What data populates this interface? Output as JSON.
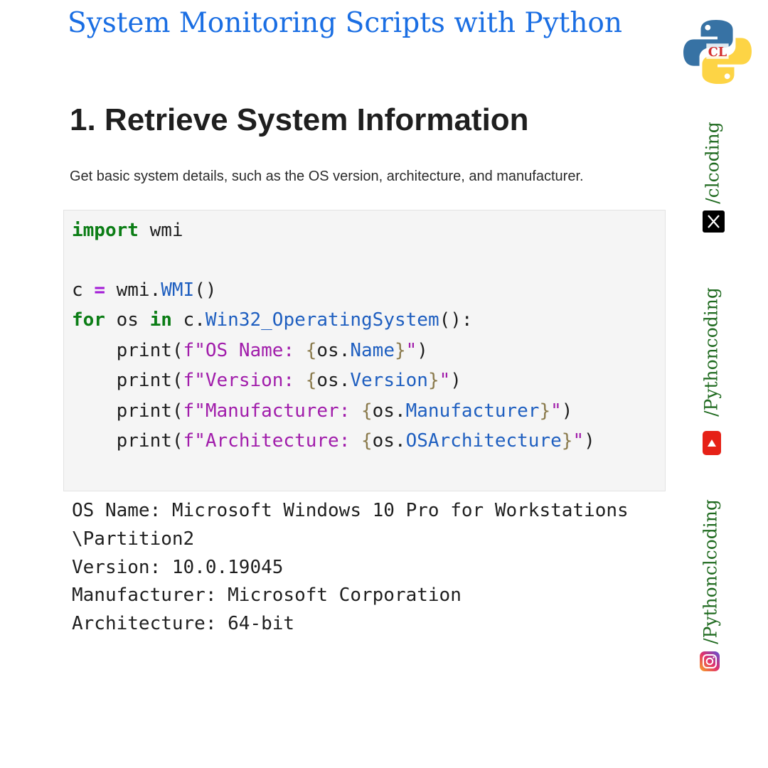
{
  "header": {
    "title": "System Monitoring Scripts with Python",
    "logo_name": "python-clcoding-logo",
    "logo_text": "CL"
  },
  "section": {
    "heading": "1. Retrieve System Information",
    "description": "Get basic system details, such as the OS version, architecture, and manufacturer."
  },
  "code": {
    "lines": [
      [
        {
          "t": "import",
          "c": "kw"
        },
        {
          "t": " wmi"
        }
      ],
      [],
      [
        {
          "t": "c "
        },
        {
          "t": "=",
          "c": "op"
        },
        {
          "t": " wmi."
        },
        {
          "t": "WMI",
          "c": "cls"
        },
        {
          "t": "()"
        }
      ],
      [
        {
          "t": "for",
          "c": "kw"
        },
        {
          "t": " os "
        },
        {
          "t": "in",
          "c": "kw"
        },
        {
          "t": " c."
        },
        {
          "t": "Win32_OperatingSystem",
          "c": "cls"
        },
        {
          "t": "():"
        }
      ],
      [
        {
          "t": "    print("
        },
        {
          "t": "f\"OS Name: ",
          "c": "str"
        },
        {
          "t": "{",
          "c": "brace"
        },
        {
          "t": "os."
        },
        {
          "t": "Name",
          "c": "cls"
        },
        {
          "t": "}",
          "c": "brace"
        },
        {
          "t": "\"",
          "c": "str"
        },
        {
          "t": ")"
        }
      ],
      [
        {
          "t": "    print("
        },
        {
          "t": "f\"Version: ",
          "c": "str"
        },
        {
          "t": "{",
          "c": "brace"
        },
        {
          "t": "os."
        },
        {
          "t": "Version",
          "c": "cls"
        },
        {
          "t": "}",
          "c": "brace"
        },
        {
          "t": "\"",
          "c": "str"
        },
        {
          "t": ")"
        }
      ],
      [
        {
          "t": "    print("
        },
        {
          "t": "f\"Manufacturer: ",
          "c": "str"
        },
        {
          "t": "{",
          "c": "brace"
        },
        {
          "t": "os."
        },
        {
          "t": "Manufacturer",
          "c": "cls"
        },
        {
          "t": "}",
          "c": "brace"
        },
        {
          "t": "\"",
          "c": "str"
        },
        {
          "t": ")"
        }
      ],
      [
        {
          "t": "    print("
        },
        {
          "t": "f\"Architecture: ",
          "c": "str"
        },
        {
          "t": "{",
          "c": "brace"
        },
        {
          "t": "os."
        },
        {
          "t": "OSArchitecture",
          "c": "cls"
        },
        {
          "t": "}",
          "c": "brace"
        },
        {
          "t": "\"",
          "c": "str"
        },
        {
          "t": ")"
        }
      ]
    ]
  },
  "output": {
    "lines": [
      "OS Name: Microsoft Windows 10 Pro for Workstations",
      "\\Partition2",
      "Version: 10.0.19045",
      "Manufacturer: Microsoft Corporation",
      "Architecture: 64-bit"
    ]
  },
  "social": {
    "twitter": {
      "handle": "/clcoding",
      "icon": "x-icon"
    },
    "youtube": {
      "handle": "/Pythoncoding",
      "icon": "youtube-icon"
    },
    "instagram": {
      "handle": "/Pythonclcoding",
      "icon": "instagram-icon"
    }
  },
  "colors": {
    "title": "#1a6ee3",
    "keyword": "#0b7d15",
    "operator": "#a21ad6",
    "attribute": "#1f5fc0",
    "string": "#a11dab",
    "brace": "#8a7a4c",
    "social_text": "#1f6a1f",
    "code_background": "#f5f5f5"
  }
}
